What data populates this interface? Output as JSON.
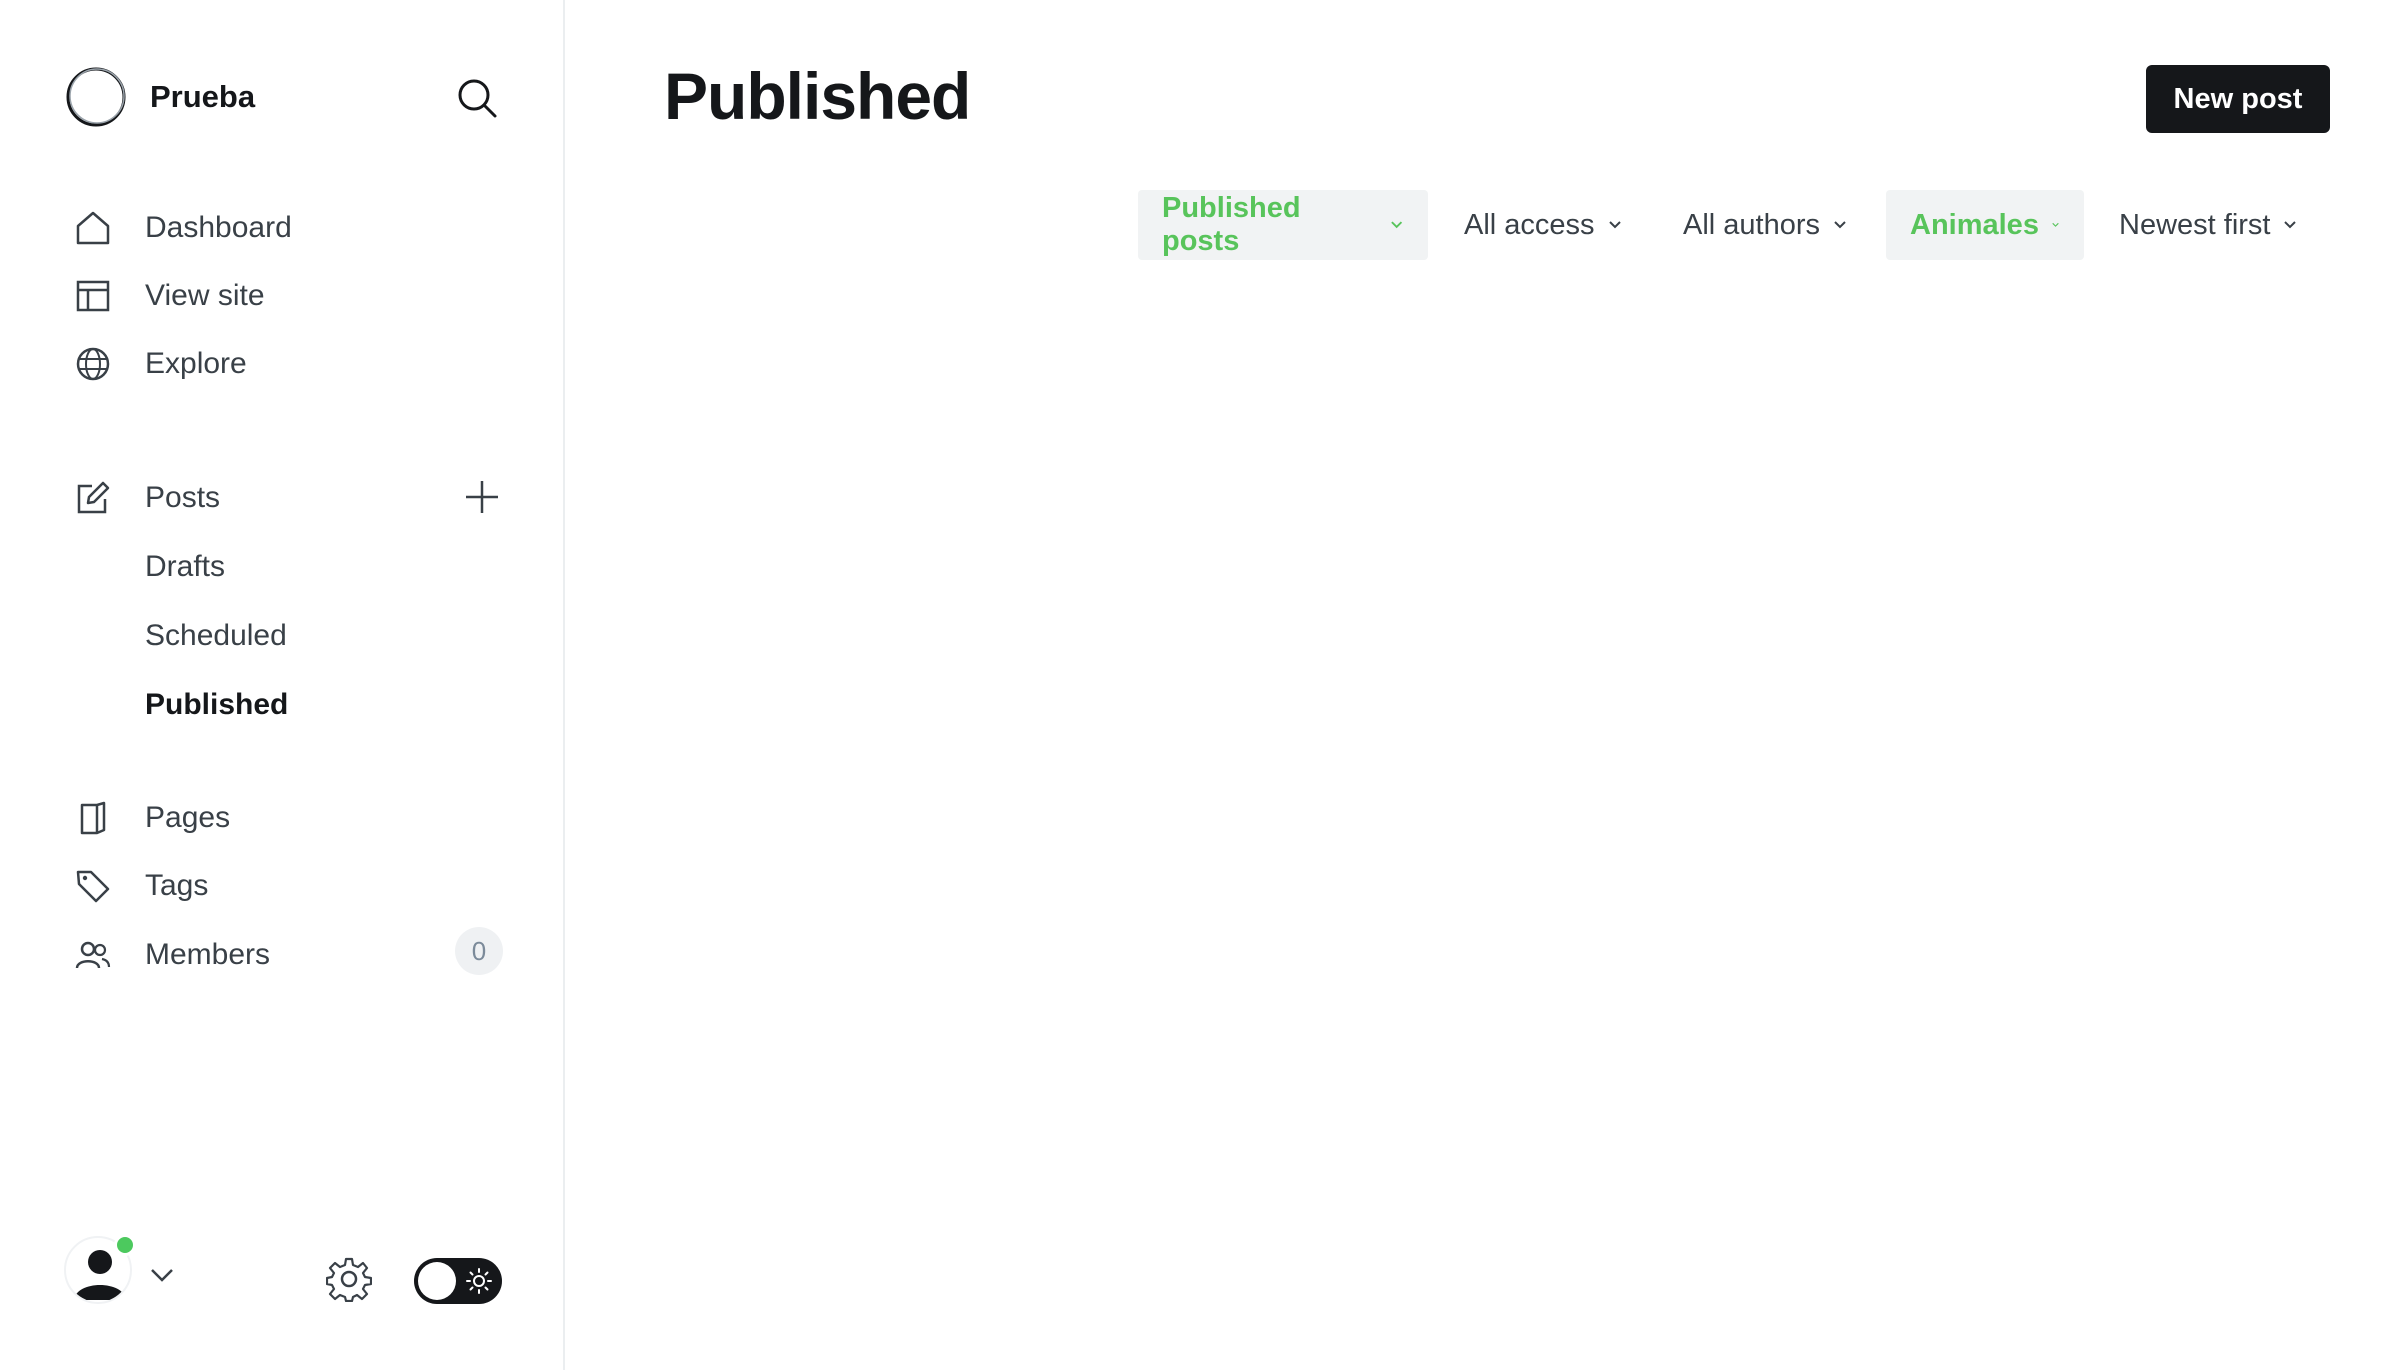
{
  "sidebar": {
    "brand_name": "Prueba",
    "nav": {
      "dashboard": "Dashboard",
      "view_site": "View site",
      "explore": "Explore",
      "posts": "Posts",
      "drafts": "Drafts",
      "scheduled": "Scheduled",
      "published": "Published",
      "pages": "Pages",
      "tags": "Tags",
      "members": "Members",
      "members_count": "0"
    },
    "status_color": "#4cc95e"
  },
  "main": {
    "title": "Published",
    "new_post_label": "New post",
    "filters": {
      "type": "Published posts",
      "access": "All access",
      "authors": "All authors",
      "tag": "Animales",
      "order": "Newest first"
    }
  },
  "colors": {
    "accent_green": "#58c45b",
    "primary_dark": "#15171a"
  },
  "icons": {
    "logo": "logo-icon",
    "search": "search-icon",
    "dashboard": "home-icon",
    "view_site": "layout-icon",
    "explore": "globe-icon",
    "posts": "edit-icon",
    "add": "plus-icon",
    "pages": "page-icon",
    "tags": "tag-icon",
    "members": "members-icon",
    "settings": "gear-icon",
    "theme": "sun-icon"
  }
}
